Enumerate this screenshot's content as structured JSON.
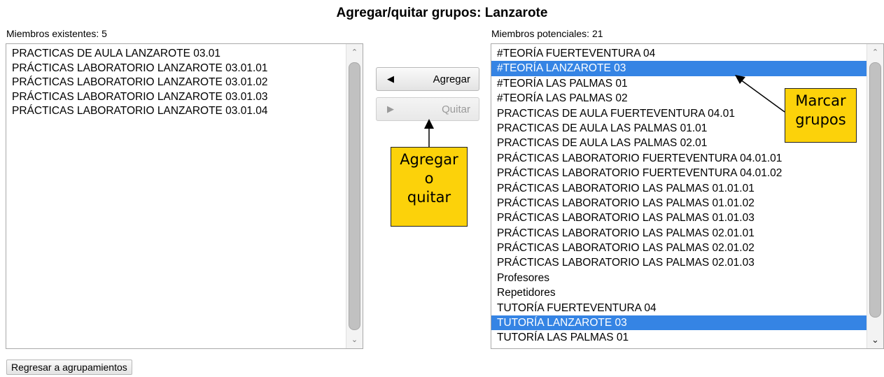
{
  "title": "Agregar/quitar grupos: Lanzarote",
  "existing": {
    "label": "Miembros existentes: 5",
    "items": [
      {
        "text": "PRACTICAS DE AULA LANZAROTE 03.01"
      },
      {
        "text": "PRÁCTICAS LABORATORIO LANZAROTE 03.01.01"
      },
      {
        "text": "PRÁCTICAS LABORATORIO LANZAROTE 03.01.02"
      },
      {
        "text": "PRÁCTICAS LABORATORIO LANZAROTE 03.01.03"
      },
      {
        "text": "PRÁCTICAS LABORATORIO LANZAROTE 03.01.04"
      }
    ]
  },
  "potential": {
    "label": "Miembros potenciales: 21",
    "items": [
      {
        "text": "#TEORÍA FUERTEVENTURA 04",
        "selected": false
      },
      {
        "text": "#TEORÍA LANZAROTE 03",
        "selected": true
      },
      {
        "text": "#TEORÍA LAS PALMAS 01",
        "selected": false
      },
      {
        "text": "#TEORÍA LAS PALMAS 02",
        "selected": false
      },
      {
        "text": "PRACTICAS DE AULA FUERTEVENTURA 04.01",
        "selected": false
      },
      {
        "text": "PRACTICAS DE AULA LAS PALMAS 01.01",
        "selected": false
      },
      {
        "text": "PRACTICAS DE AULA LAS PALMAS 02.01",
        "selected": false
      },
      {
        "text": "PRÁCTICAS LABORATORIO FUERTEVENTURA 04.01.01",
        "selected": false
      },
      {
        "text": "PRÁCTICAS LABORATORIO FUERTEVENTURA 04.01.02",
        "selected": false
      },
      {
        "text": "PRÁCTICAS LABORATORIO LAS PALMAS 01.01.01",
        "selected": false
      },
      {
        "text": "PRÁCTICAS LABORATORIO LAS PALMAS 01.01.02",
        "selected": false
      },
      {
        "text": "PRÁCTICAS LABORATORIO LAS PALMAS 01.01.03",
        "selected": false
      },
      {
        "text": "PRÁCTICAS LABORATORIO LAS PALMAS 02.01.01",
        "selected": false
      },
      {
        "text": "PRÁCTICAS LABORATORIO LAS PALMAS 02.01.02",
        "selected": false
      },
      {
        "text": "PRÁCTICAS LABORATORIO LAS PALMAS 02.01.03",
        "selected": false
      },
      {
        "text": "Profesores",
        "selected": false
      },
      {
        "text": "Repetidores",
        "selected": false
      },
      {
        "text": "TUTORÍA FUERTEVENTURA 04",
        "selected": false
      },
      {
        "text": "TUTORÍA LANZAROTE 03",
        "selected": true
      },
      {
        "text": "TUTORÍA LAS PALMAS 01",
        "selected": false
      }
    ]
  },
  "buttons": {
    "add_label": "Agregar",
    "add_icon": "left-triangle-icon",
    "remove_label": "Quitar",
    "remove_icon": "right-triangle-icon",
    "back_label": "Regresar a agrupamientos"
  },
  "callouts": {
    "add_remove": [
      "Agregar",
      "o",
      "quitar"
    ],
    "mark": [
      "Marcar",
      "grupos"
    ],
    "color": "#fcd20a"
  },
  "colors": {
    "selection": "#3584e4"
  }
}
